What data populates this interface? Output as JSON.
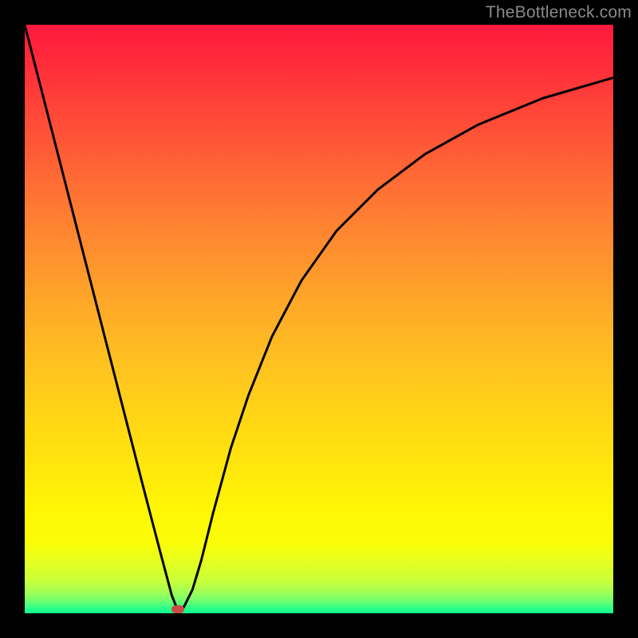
{
  "watermark": {
    "text": "TheBottleneck.com"
  },
  "marker": {
    "x_pct": 26.0,
    "y_pct": 99.3,
    "color": "#cb4b45"
  },
  "chart_data": {
    "type": "line",
    "title": "",
    "xlabel": "",
    "ylabel": "",
    "xlim": [
      0,
      100
    ],
    "ylim": [
      0,
      100
    ],
    "grid": false,
    "legend": false,
    "annotations": [
      {
        "text": "TheBottleneck.com",
        "pos": "top-right"
      }
    ],
    "background": {
      "type": "vertical-gradient",
      "stops": [
        {
          "pct": 0,
          "color": "#ff1a3c"
        },
        {
          "pct": 50,
          "color": "#ffb024"
        },
        {
          "pct": 85,
          "color": "#fff706"
        },
        {
          "pct": 100,
          "color": "#0cff90"
        }
      ]
    },
    "series": [
      {
        "name": "bottleneck-curve",
        "color": "#000000",
        "x": [
          0,
          5,
          10,
          15,
          20,
          23,
          25,
          26,
          27,
          28.5,
          30,
          32,
          35,
          38,
          42,
          47,
          53,
          60,
          68,
          77,
          88,
          100
        ],
        "y": [
          0,
          19.5,
          39,
          58.5,
          78,
          89.5,
          97,
          99.5,
          99,
          96,
          91,
          83,
          72,
          63,
          53,
          43.5,
          35,
          28,
          22,
          17,
          12.5,
          9
        ]
      }
    ],
    "markers": [
      {
        "name": "minimum-point",
        "x": 26,
        "y": 99.3,
        "color": "#cb4b45",
        "shape": "rounded-rect"
      }
    ],
    "notes": "y values are heights from top in the plotted visual; larger y = lower on the chart (curve dips to bottom near x≈26)."
  }
}
